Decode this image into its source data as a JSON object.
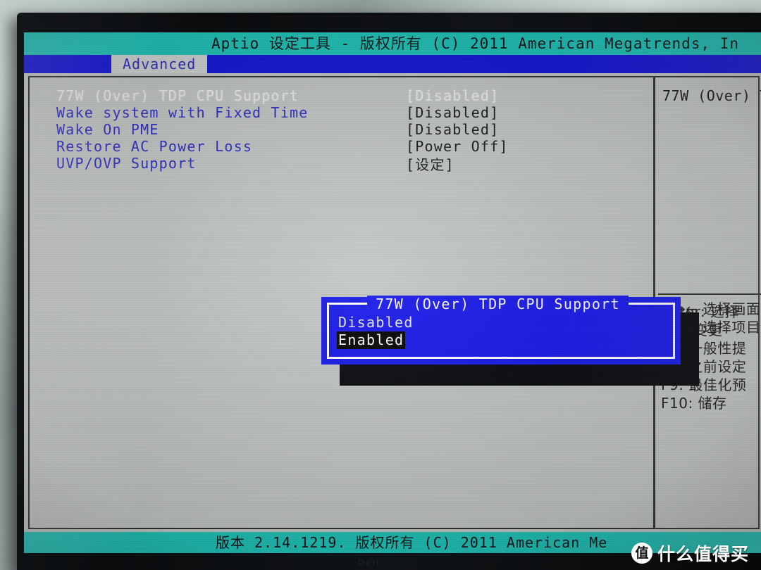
{
  "window": {
    "title": "Aptio 设定工具 - 版权所有 (C) 2011 American Megatrends, In",
    "footer": "版本 2.14.1219. 版权所有 (C) 2011 American Me",
    "stand_brand": "Dell"
  },
  "menubar": {
    "active_tab": "Advanced"
  },
  "settings": {
    "rows": [
      {
        "label": "77W (Over) TDP CPU Support",
        "value": "[Disabled]",
        "state": "focused"
      },
      {
        "label": "Wake system with Fixed Time",
        "value": "[Disabled]",
        "state": "normal"
      },
      {
        "label": "Wake On PME",
        "value": "[Disabled]",
        "state": "normal"
      },
      {
        "label": "Restore AC Power Loss",
        "value": "[Power Off]",
        "state": "normal"
      },
      {
        "label": "UVP/OVP Support",
        "value": "[设定]",
        "state": "normal"
      }
    ]
  },
  "help": {
    "topic": "77W (Over) T",
    "arrows": [
      {
        "glyph": "→←",
        "label": "选择画面"
      },
      {
        "glyph": "↑↓",
        "label": "选择项目"
      }
    ],
    "keys": [
      "Enter: 选择",
      "+/-: 变更",
      "F1: 一般性提",
      "F7: 之前设定",
      "F9: 最佳化预",
      "F10: 储存  "
    ]
  },
  "popup": {
    "title": "77W (Over) TDP CPU Support",
    "options": [
      {
        "label": "Disabled",
        "selected": false
      },
      {
        "label": "Enabled",
        "selected": true
      }
    ]
  },
  "watermark": {
    "badge": "值",
    "text": "什么值得买"
  },
  "colors": {
    "titlebar_teal": "#1fc3b8",
    "menubar_blue": "#1515d8",
    "popup_blue": "#1515ec",
    "panel_gray": "#c2c6c3",
    "item_blue": "#2b2bc4",
    "value_black": "#17191b",
    "selection_black": "#000000"
  }
}
